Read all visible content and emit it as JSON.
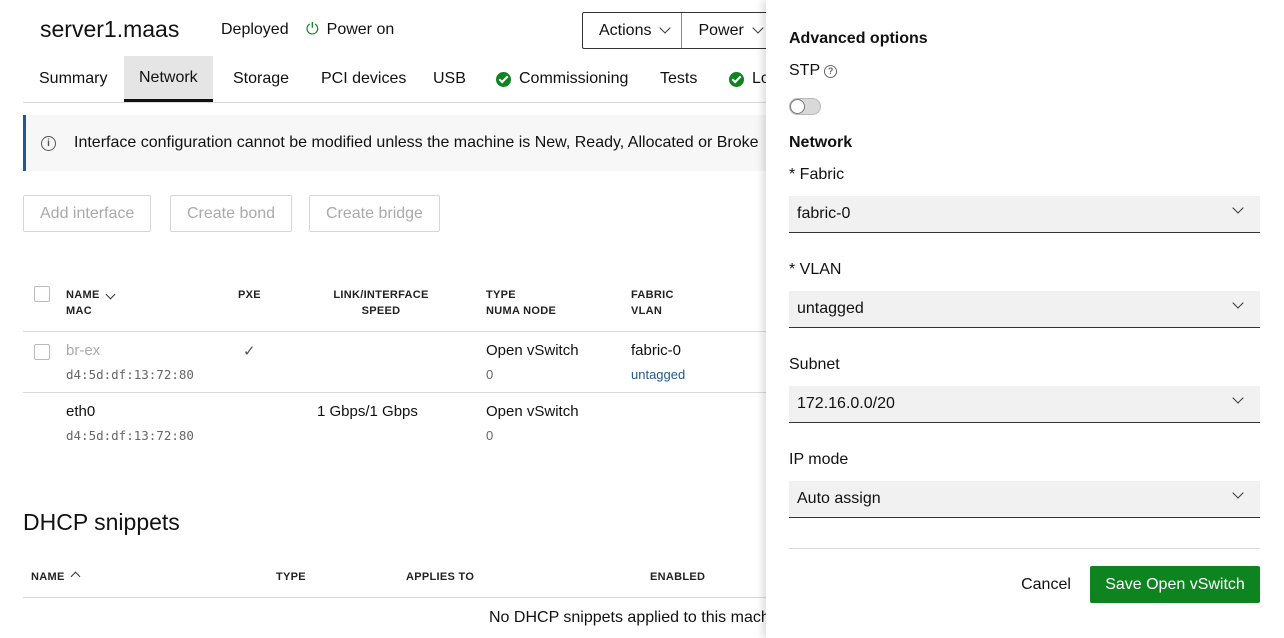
{
  "header": {
    "title": "server1.maas",
    "status": "Deployed",
    "power_status": "Power on",
    "actions_label": "Actions",
    "power_label": "Power"
  },
  "tabs": [
    {
      "label": "Summary"
    },
    {
      "label": "Network"
    },
    {
      "label": "Storage"
    },
    {
      "label": "PCI devices"
    },
    {
      "label": "USB"
    },
    {
      "label": "Commissioning"
    },
    {
      "label": "Tests"
    },
    {
      "label": "Lo"
    }
  ],
  "notice": "Interface configuration cannot be modified unless the machine is New, Ready, Allocated or Broke",
  "actions": {
    "add_interface": "Add interface",
    "create_bond": "Create bond",
    "create_bridge": "Create bridge"
  },
  "table": {
    "headers": {
      "name": "NAME",
      "mac": "MAC",
      "pxe": "PXE",
      "link_line1": "LINK/INTERFACE",
      "link_line2": "SPEED",
      "type": "TYPE",
      "numa": "NUMA NODE",
      "fabric": "FABRIC",
      "vlan": "VLAN"
    },
    "rows": [
      {
        "name": "br-ex",
        "mac": "d4:5d:df:13:72:80",
        "pxe": "✓",
        "speed": "",
        "type": "Open vSwitch",
        "numa": "0",
        "fabric": "fabric-0",
        "vlan": "untagged"
      },
      {
        "name": "eth0",
        "mac": "d4:5d:df:13:72:80",
        "pxe": "",
        "speed": "1 Gbps/1 Gbps",
        "type": "Open vSwitch",
        "numa": "0",
        "fabric": "",
        "vlan": ""
      }
    ]
  },
  "dhcp": {
    "title": "DHCP snippets",
    "headers": {
      "name": "NAME",
      "type": "TYPE",
      "applies_to": "APPLIES TO",
      "enabled": "ENABLED"
    },
    "empty": "No DHCP snippets applied to this mach"
  },
  "panel": {
    "advanced_title": "Advanced options",
    "stp_label": "STP",
    "network_title": "Network",
    "fabric_label": "* Fabric",
    "fabric_value": "fabric-0",
    "vlan_label": "* VLAN",
    "vlan_value": "untagged",
    "subnet_label": "Subnet",
    "subnet_value": "172.16.0.0/20",
    "ipmode_label": "IP mode",
    "ipmode_value": "Auto assign",
    "cancel_label": "Cancel",
    "save_label": "Save Open vSwitch",
    "stp_enabled": false
  },
  "colors": {
    "accent": "#0e8420",
    "link": "#24598f",
    "notice_border": "#24598f"
  }
}
